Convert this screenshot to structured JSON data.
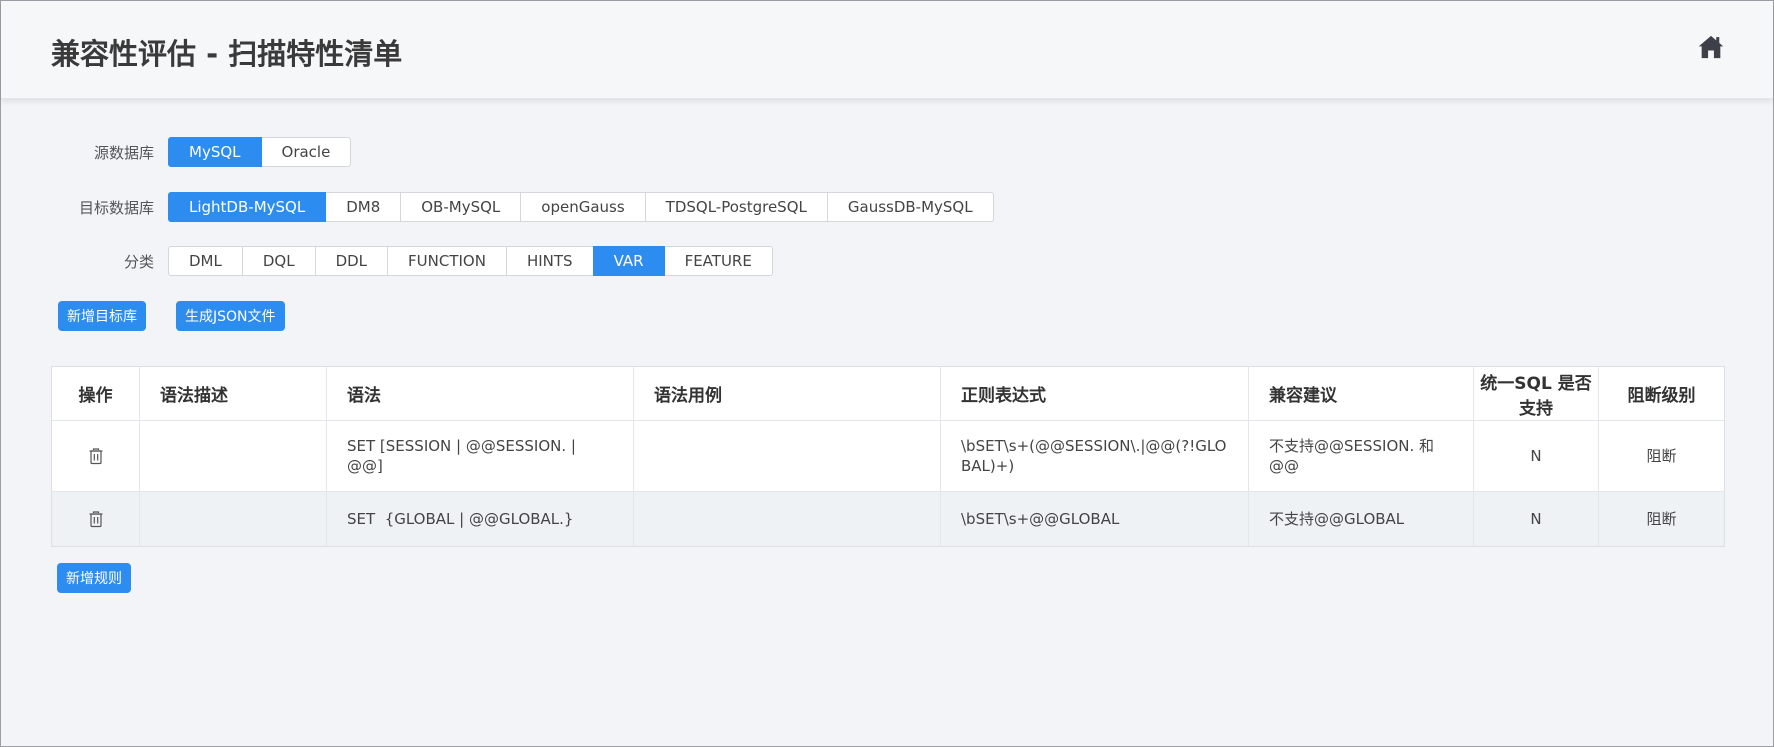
{
  "header": {
    "title": "兼容性评估 - 扫描特性清单",
    "home_icon": "home-icon"
  },
  "source_db": {
    "label": "源数据库",
    "options": [
      "MySQL",
      "Oracle"
    ],
    "selected": "MySQL"
  },
  "target_db": {
    "label": "目标数据库",
    "options": [
      "LightDB-MySQL",
      "DM8",
      "OB-MySQL",
      "openGauss",
      "TDSQL-PostgreSQL",
      "GaussDB-MySQL"
    ],
    "selected": "LightDB-MySQL"
  },
  "category": {
    "label": "分类",
    "options": [
      "DML",
      "DQL",
      "DDL",
      "FUNCTION",
      "HINTS",
      "VAR",
      "FEATURE"
    ],
    "selected": "VAR"
  },
  "actions": {
    "add_target": "新增目标库",
    "gen_json": "生成JSON文件",
    "add_rule": "新增规则"
  },
  "table": {
    "headers": [
      "操作",
      "语法描述",
      "语法",
      "语法用例",
      "正则表达式",
      "兼容建议",
      "统一SQL 是否支持",
      "阻断级别"
    ],
    "rows": [
      {
        "description": "",
        "syntax": "SET [SESSION | @@SESSION. | @@]",
        "example": "",
        "regex": "\\bSET\\s+(@@SESSION\\.|@@(?!GLOBAL)+)",
        "advice": "不支持@@SESSION. 和 @@",
        "supported": "N",
        "level": "阻断"
      },
      {
        "description": "",
        "syntax": "SET  {GLOBAL | @@GLOBAL.}",
        "example": "",
        "regex": "\\bSET\\s+@@GLOBAL",
        "advice": "不支持@@GLOBAL",
        "supported": "N",
        "level": "阻断"
      }
    ]
  },
  "colors": {
    "accent": "#2d8cf0",
    "background": "#f2f4f7"
  }
}
